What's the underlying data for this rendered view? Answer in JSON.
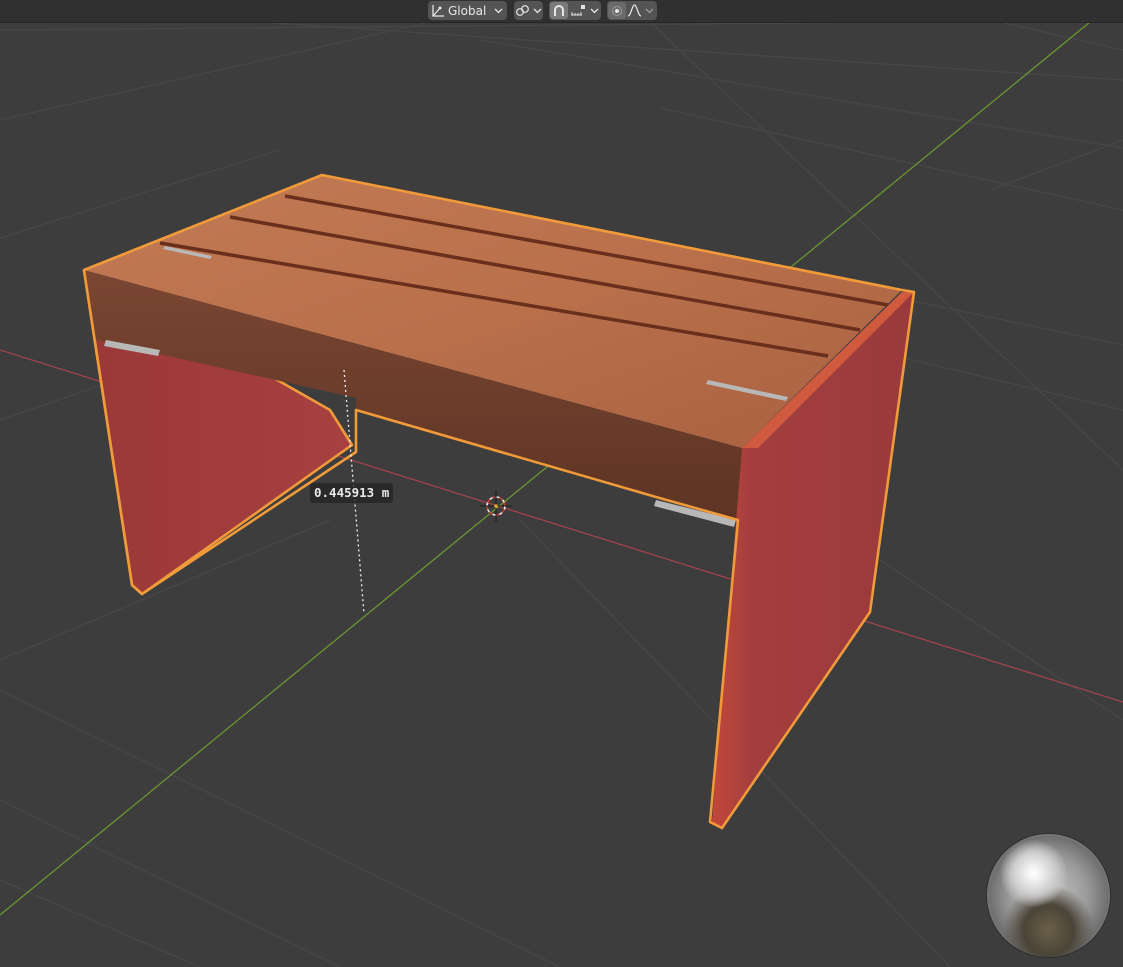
{
  "header": {
    "orientation": {
      "label": "Global",
      "icon": "transform-orientation-icon"
    },
    "pivot": {
      "icon": "pivot-point-icon"
    },
    "snap": {
      "icon": "snap-magnet-icon",
      "target_icon": "snap-increment-icon"
    },
    "proportional": {
      "icon": "proportional-editing-icon",
      "falloff_icon": "falloff-curve-icon"
    }
  },
  "viewport": {
    "measurement": "0.445913 m",
    "colors": {
      "selection_outline": "#f09a3a",
      "x_axis": "#b0444e",
      "y_axis": "#6f9a38",
      "leg_red": "#a83d3d",
      "wood": "#b46a46"
    },
    "widgets": [
      "3d-cursor",
      "matcap-preview-sphere"
    ]
  }
}
